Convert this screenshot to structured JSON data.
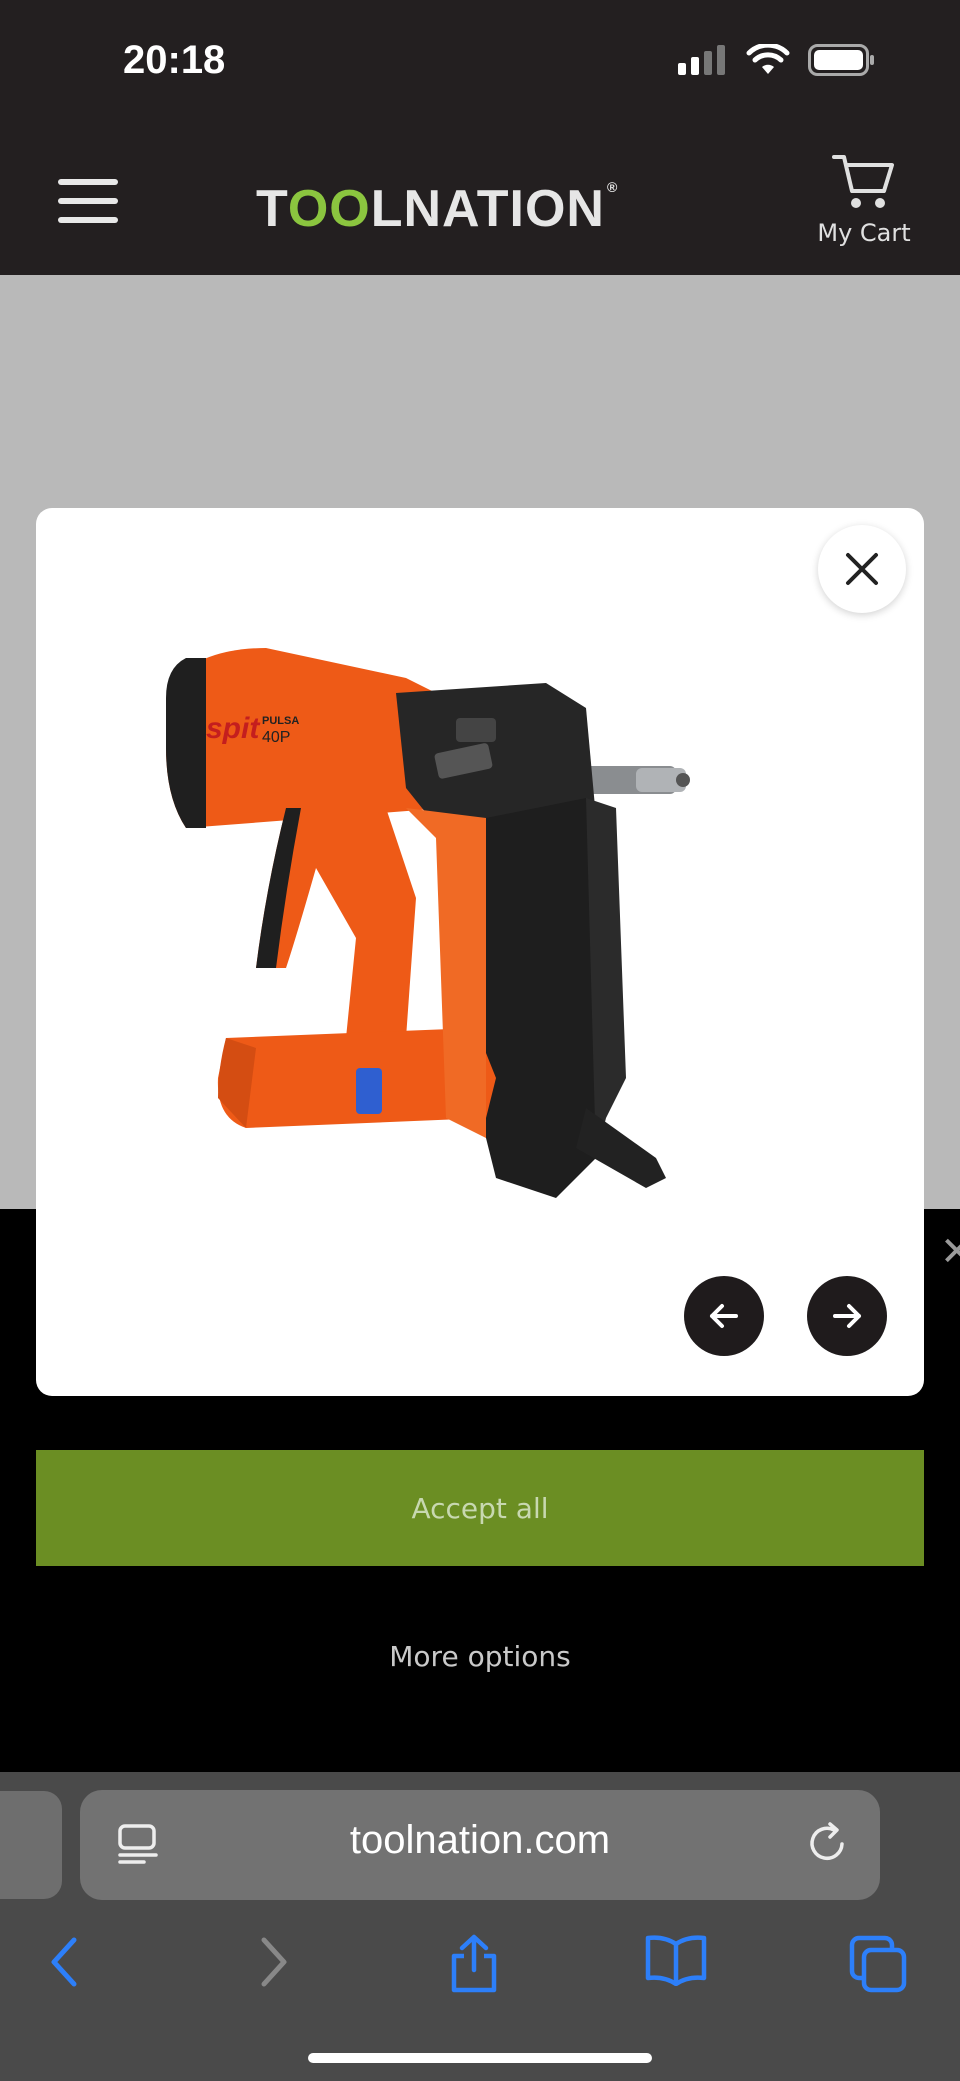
{
  "status_bar": {
    "time": "20:18"
  },
  "header": {
    "logo": {
      "part1": "T",
      "part2": "OO",
      "part3": "LNATION",
      "reg": "®"
    },
    "cart_label": "My Cart"
  },
  "modal": {
    "product_image_alt": "SPIT Pulsa 40P",
    "product_brand": "spit",
    "product_model_line": "PULSA",
    "product_model": "40P"
  },
  "cookie": {
    "accept_label": "Accept all",
    "more_options_label": "More options"
  },
  "browser": {
    "url": "toolnation.com"
  },
  "colors": {
    "brand_green": "#8bc53f",
    "accept_green": "#6b8e23",
    "ios_blue": "#2d7ff9"
  }
}
